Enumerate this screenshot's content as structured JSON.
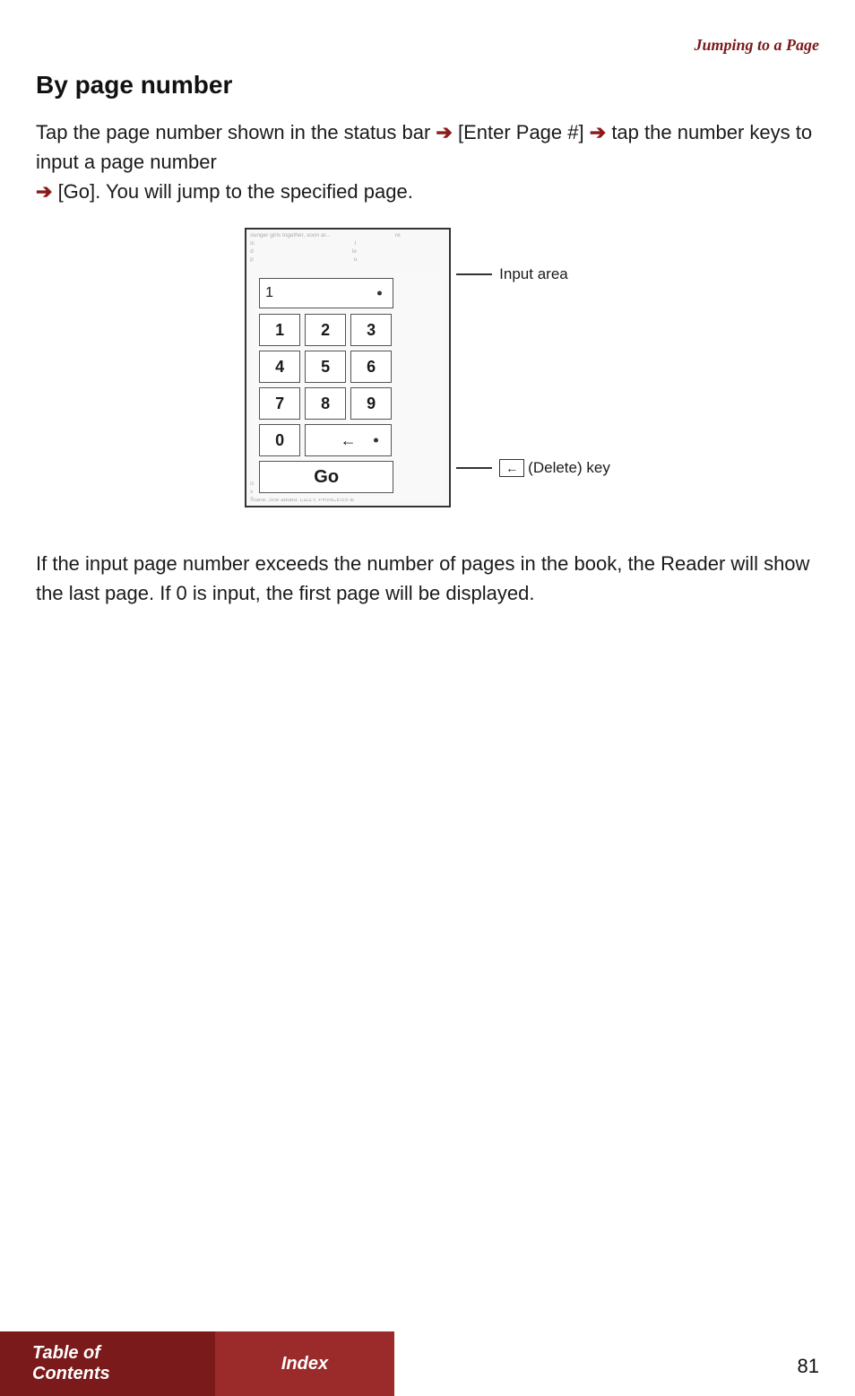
{
  "page": {
    "header": {
      "title": "Jumping to a Page"
    },
    "section": {
      "title": "By page number",
      "body1": "Tap the page number shown in the status bar",
      "arrow1": "➔",
      "body1b": "[Enter Page #]",
      "arrow2": "➔",
      "body1c": "tap the number keys to input a page number",
      "arrow3": "➔",
      "body1d": "[Go]. You will jump to the specified page.",
      "body2": "If the input page number exceeds the number of pages in the book, the Reader will show the last page. If 0 is input, the first page will be displayed."
    },
    "diagram": {
      "bg_text_top": "ounger girls together, soon ar... ic d p",
      "bg_text_bottom": "Stane. She added: LIZZY, PRINCESS lit",
      "input_value": "1",
      "keys": [
        "1",
        "2",
        "3",
        "4",
        "5",
        "6",
        "7",
        "8",
        "9",
        "0"
      ],
      "go_label": "Go",
      "annotation_input": "Input area",
      "annotation_delete_label": "(Delete) key"
    },
    "bottom_nav": {
      "toc_label": "Table of Contents",
      "index_label": "Index"
    },
    "page_number": "81"
  }
}
